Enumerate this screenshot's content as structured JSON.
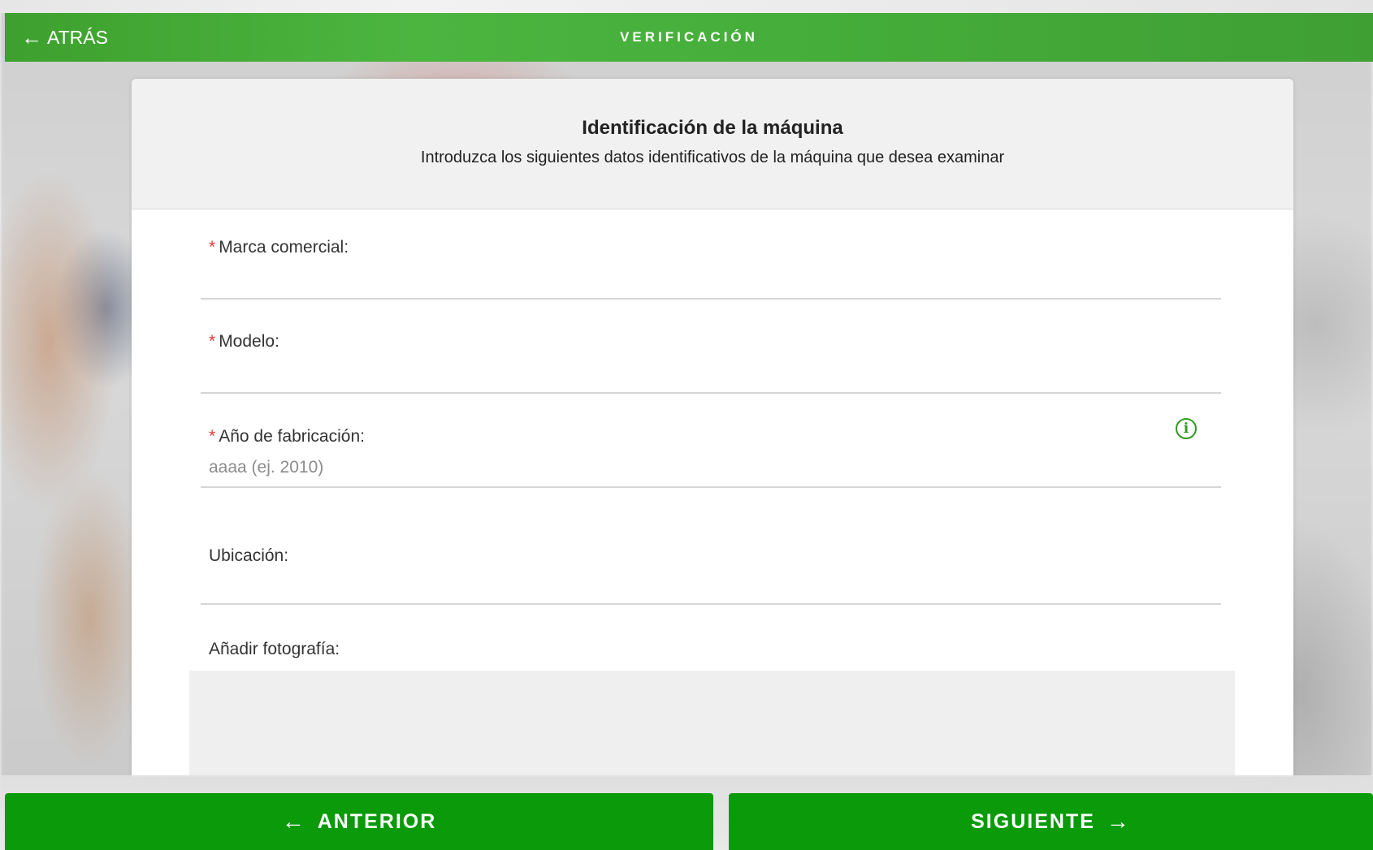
{
  "header": {
    "back_icon": "arrow-left-icon",
    "back_label": "ATRÁS",
    "title": "VERIFICACIÓN",
    "color": "#45ad3a"
  },
  "card": {
    "title": "Identificación de la máquina",
    "subtitle": "Introduzca los siguientes datos identificativos de la máquina que desea examinar"
  },
  "fields": {
    "brand": {
      "required_mark": "*",
      "label": "Marca comercial:",
      "value": "",
      "placeholder": ""
    },
    "model": {
      "required_mark": "*",
      "label": "Modelo:",
      "value": "",
      "placeholder": ""
    },
    "year": {
      "required_mark": "*",
      "label": "Año de fabricación:",
      "value": "",
      "placeholder": "aaaa (ej. 2010)",
      "info_icon": "info-icon"
    },
    "location": {
      "label": "Ubicación:",
      "value": "",
      "placeholder": ""
    },
    "photo": {
      "label": "Añadir fotografía:"
    }
  },
  "footer": {
    "prev_label": "ANTERIOR",
    "prev_icon": "arrow-left-icon",
    "next_label": "SIGUIENTE",
    "next_icon": "arrow-right-icon",
    "button_color": "#0a9a0a"
  }
}
